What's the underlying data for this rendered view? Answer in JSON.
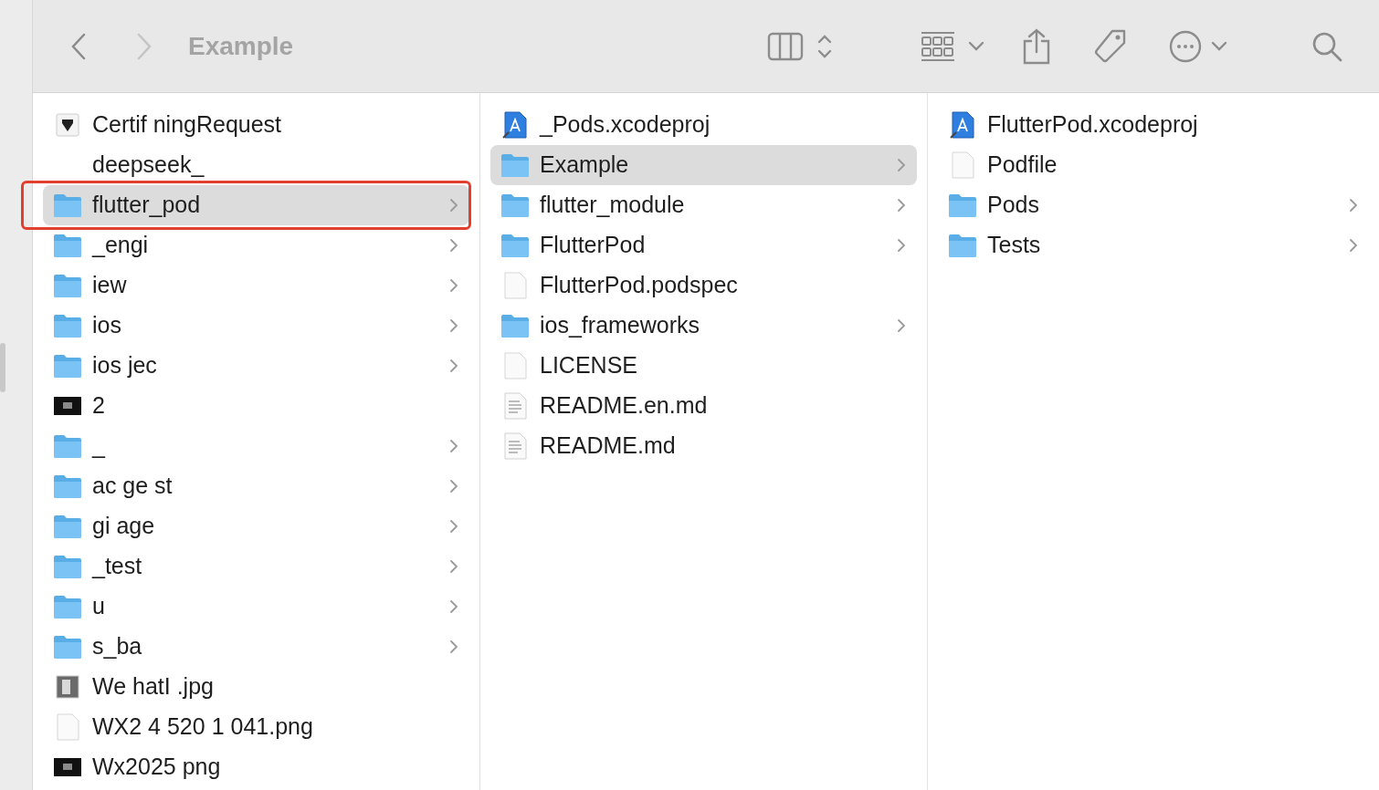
{
  "toolbar": {
    "title": "Example"
  },
  "columns": [
    {
      "items": [
        {
          "name": "Certif ningRequest",
          "kind": "certificate",
          "selected": false,
          "outlined": false,
          "has_children": false
        },
        {
          "name": "deepseek_",
          "kind": "none",
          "selected": false,
          "outlined": false,
          "has_children": false
        },
        {
          "name": "flutter_pod",
          "kind": "folder",
          "selected": true,
          "outlined": true,
          "has_children": true
        },
        {
          "name": "_engi",
          "kind": "folder",
          "selected": false,
          "outlined": false,
          "has_children": true
        },
        {
          "name": "iew",
          "kind": "folder",
          "selected": false,
          "outlined": false,
          "has_children": true
        },
        {
          "name": "ios",
          "kind": "folder",
          "selected": false,
          "outlined": false,
          "has_children": true
        },
        {
          "name": "ios jec",
          "kind": "folder",
          "selected": false,
          "outlined": false,
          "has_children": true
        },
        {
          "name": "2",
          "kind": "screenshot",
          "selected": false,
          "outlined": false,
          "has_children": false
        },
        {
          "name": "_",
          "kind": "folder",
          "selected": false,
          "outlined": false,
          "has_children": true
        },
        {
          "name": "ac ge st",
          "kind": "folder",
          "selected": false,
          "outlined": false,
          "has_children": true
        },
        {
          "name": "gi age",
          "kind": "folder",
          "selected": false,
          "outlined": false,
          "has_children": true
        },
        {
          "name": "_test",
          "kind": "folder",
          "selected": false,
          "outlined": false,
          "has_children": true
        },
        {
          "name": "u",
          "kind": "folder",
          "selected": false,
          "outlined": false,
          "has_children": true
        },
        {
          "name": "s_ba",
          "kind": "folder",
          "selected": false,
          "outlined": false,
          "has_children": true
        },
        {
          "name": "We hatI .jpg",
          "kind": "image",
          "selected": false,
          "outlined": false,
          "has_children": false
        },
        {
          "name": "WX2 4 520 1 041.png",
          "kind": "blank",
          "selected": false,
          "outlined": false,
          "has_children": false
        },
        {
          "name": "Wx2025 png",
          "kind": "screenshot",
          "selected": false,
          "outlined": false,
          "has_children": false
        }
      ]
    },
    {
      "items": [
        {
          "name": "_Pods.xcodeproj",
          "kind": "xcodeproj",
          "selected": false,
          "outlined": false,
          "has_children": false
        },
        {
          "name": "Example",
          "kind": "folder",
          "selected": true,
          "outlined": false,
          "has_children": true
        },
        {
          "name": "flutter_module",
          "kind": "folder",
          "selected": false,
          "outlined": false,
          "has_children": true
        },
        {
          "name": "FlutterPod",
          "kind": "folder",
          "selected": false,
          "outlined": false,
          "has_children": true
        },
        {
          "name": "FlutterPod.podspec",
          "kind": "blank",
          "selected": false,
          "outlined": false,
          "has_children": false
        },
        {
          "name": "ios_frameworks",
          "kind": "folder",
          "selected": false,
          "outlined": false,
          "has_children": true
        },
        {
          "name": "LICENSE",
          "kind": "blank",
          "selected": false,
          "outlined": false,
          "has_children": false
        },
        {
          "name": "README.en.md",
          "kind": "text",
          "selected": false,
          "outlined": false,
          "has_children": false
        },
        {
          "name": "README.md",
          "kind": "text",
          "selected": false,
          "outlined": false,
          "has_children": false
        }
      ]
    },
    {
      "items": [
        {
          "name": "FlutterPod.xcodeproj",
          "kind": "xcodeproj",
          "selected": false,
          "outlined": false,
          "has_children": false
        },
        {
          "name": "Podfile",
          "kind": "blank",
          "selected": false,
          "outlined": false,
          "has_children": false
        },
        {
          "name": "Pods",
          "kind": "folder",
          "selected": false,
          "outlined": false,
          "has_children": true
        },
        {
          "name": "Tests",
          "kind": "folder",
          "selected": false,
          "outlined": false,
          "has_children": true
        }
      ]
    }
  ]
}
